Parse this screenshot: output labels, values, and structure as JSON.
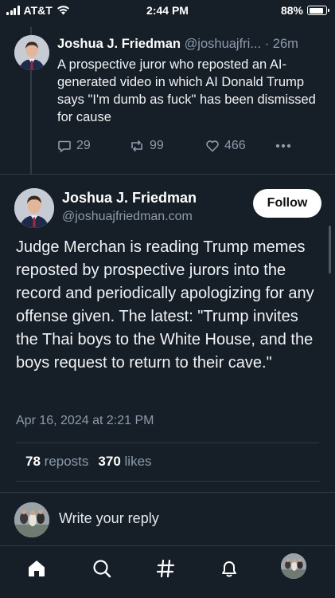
{
  "status_bar": {
    "carrier": "AT&T",
    "time": "2:44 PM",
    "battery": "88%",
    "battery_level": 0.88
  },
  "parent_post": {
    "author_name": "Joshua J. Friedman",
    "author_handle": "@joshuajfri...",
    "separator": "·",
    "time_ago": "26m",
    "text": "A prospective juror who reposted an AI-generated video in which AI Donald Trump says \"I'm dumb as fuck\" has been dismissed for cause",
    "replies": "29",
    "reposts": "99",
    "likes": "466",
    "more_icon": "more-horizontal-icon"
  },
  "main_post": {
    "author_name": "Joshua J. Friedman",
    "author_handle": "@joshuajfriedman.com",
    "follow_label": "Follow",
    "text": "Judge Merchan is reading Trump memes reposted by prospective jurors into the record and periodically apologizing for any offense given. The latest: \"Trump invites the Thai boys to the White House, and the boys request to return to their cave.\"",
    "date": "Apr 16, 2024 at 2:21 PM",
    "reposts_count": "78",
    "reposts_label": "reposts",
    "likes_count": "370",
    "likes_label": "likes"
  },
  "reply_composer": {
    "placeholder": "Write your reply"
  },
  "tab_bar": {
    "items": [
      "home-icon",
      "search-icon",
      "feeds-hash-icon",
      "notifications-bell-icon",
      "profile-avatar"
    ]
  },
  "colors": {
    "background": "#161e27",
    "muted_text": "#8c9bab",
    "divider": "#2c3a49",
    "follow_button": "#ffffff"
  }
}
